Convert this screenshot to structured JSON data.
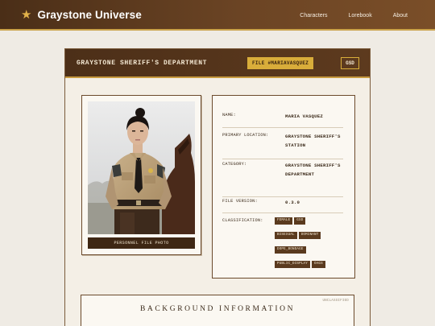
{
  "app": {
    "title": "Graystone Universe",
    "logo_icon": "star-icon"
  },
  "nav": [
    {
      "label": "Characters"
    },
    {
      "label": "Lorebook"
    },
    {
      "label": "About"
    }
  ],
  "header": {
    "department": "GRAYSTONE SHERIFF'S DEPARTMENT",
    "file_tag": "FILE #MARIAVASQUEZ",
    "badge": "GSD"
  },
  "photo": {
    "caption": "PERSONNEL FILE PHOTO"
  },
  "profile": {
    "name_label": "NAME:",
    "name": "MARIA VASQUEZ",
    "location_label": "PRIMARY LOCATION:",
    "location": "GRAYSTONE SHERIFF'S STATION",
    "category_label": "CATEGORY:",
    "category": "GRAYSTONE SHERIFF'S DEPARTMENT",
    "version_label": "FILE VERSION:",
    "version": "0.3.0",
    "classification_label": "CLASSIFICATION:",
    "tags": [
      "FEMALE",
      "GSD",
      "BISEXUAL",
      "DOMINANT",
      "DOPE_BONDAGE",
      "PUBLIC_DISPLAY",
      "OAGS"
    ]
  },
  "background": {
    "stamp": "UNCLASSIFIED",
    "title": "BACKGROUND INFORMATION"
  },
  "colors": {
    "header_brown": "#4c2f18",
    "gold_accent": "#d9ad3a",
    "paper": "#fbf8f2",
    "page_bg": "#efebe4"
  }
}
